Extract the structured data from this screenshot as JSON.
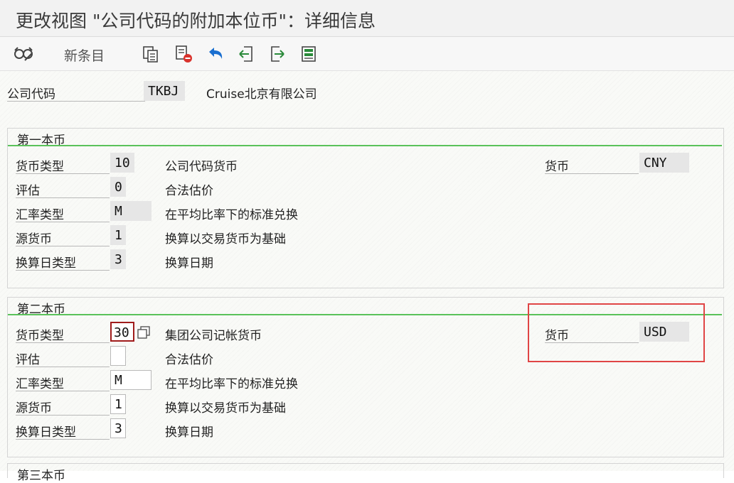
{
  "window": {
    "title": "更改视图 \"公司代码的附加本位币\"：详细信息"
  },
  "toolbar": {
    "new_entries_label": "新条目"
  },
  "header": {
    "company_code_label": "公司代码",
    "company_code_value": "TKBJ",
    "company_name": "Cruise北京有限公司"
  },
  "section1": {
    "title": "第一本币",
    "currency_type_label": "货币类型",
    "currency_type_value": "10",
    "currency_type_desc": "公司代码货币",
    "valuation_label": "评估",
    "valuation_value": "0",
    "valuation_desc": "合法估价",
    "rate_type_label": "汇率类型",
    "rate_type_value": "M",
    "rate_type_desc": "在平均比率下的标准兑换",
    "source_currency_label": "源货币",
    "source_currency_value": "1",
    "source_currency_desc": "换算以交易货币为基础",
    "date_type_label": "换算日类型",
    "date_type_value": "3",
    "date_type_desc": "换算日期",
    "currency_label": "货币",
    "currency_value": "CNY"
  },
  "section2": {
    "title": "第二本币",
    "currency_type_label": "货币类型",
    "currency_type_value": "30",
    "currency_type_desc": "集团公司记帐货币",
    "valuation_label": "评估",
    "valuation_value": "",
    "valuation_desc": "合法估价",
    "rate_type_label": "汇率类型",
    "rate_type_value": "M",
    "rate_type_desc": "在平均比率下的标准兑换",
    "source_currency_label": "源货币",
    "source_currency_value": "1",
    "source_currency_desc": "换算以交易货币为基础",
    "date_type_label": "换算日类型",
    "date_type_value": "3",
    "date_type_desc": "换算日期",
    "currency_label": "货币",
    "currency_value": "USD"
  },
  "section3": {
    "title": "第三本币"
  },
  "icons": [
    "glasses-display-change-icon",
    "copy-icon",
    "delete-icon",
    "undo-icon",
    "previous-entry-icon",
    "next-entry-icon",
    "select-all-icon",
    "f4-help-icon"
  ],
  "colors": {
    "accent_line": "#5ac25a",
    "highlight_box": "#e04545"
  }
}
